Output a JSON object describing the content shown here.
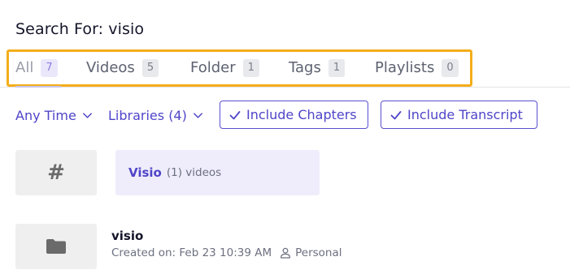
{
  "header": {
    "title": "Search For: visio"
  },
  "tabs": [
    {
      "label": "All",
      "count": "7"
    },
    {
      "label": "Videos",
      "count": "5"
    },
    {
      "label": "Folder",
      "count": "1"
    },
    {
      "label": "Tags",
      "count": "1"
    },
    {
      "label": "Playlists",
      "count": "0"
    }
  ],
  "filters": {
    "time": "Any Time",
    "libraries": "Libraries (4)",
    "include_chapters": "Include Chapters",
    "include_transcript": "Include Transcript"
  },
  "tag_result": {
    "icon_text": "#",
    "name": "Visio",
    "count": "(1) videos"
  },
  "folder_result": {
    "name": "visio",
    "created": "Created on: Feb 23 10:39 AM",
    "owner": "Personal"
  },
  "colors": {
    "accent": "#4f45c8",
    "highlight_box": "#f4ae1a"
  }
}
